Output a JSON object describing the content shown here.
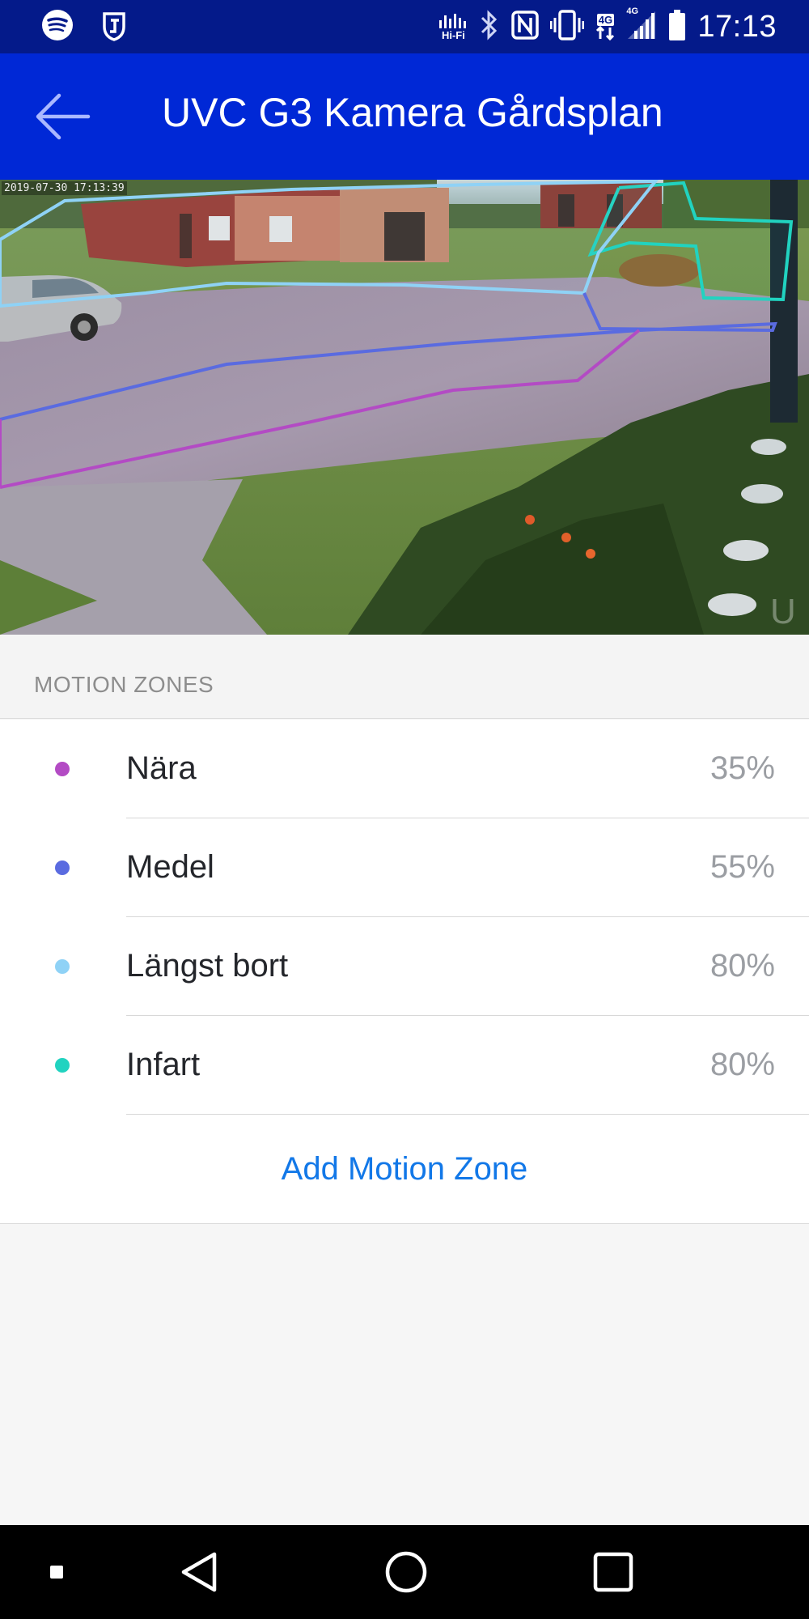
{
  "status_bar": {
    "left_icons": [
      "spotify-icon",
      "app-notification-icon"
    ],
    "hifi_label": "Hi-Fi",
    "network_label": "4G",
    "signal_label": "4G",
    "time": "17:13"
  },
  "app_bar": {
    "title": "UVC G3 Kamera Gårdsplan",
    "back_icon": "back-arrow-icon"
  },
  "camera": {
    "timestamp": "2019-07-30 17:13:39"
  },
  "section": {
    "title": "MOTION ZONES"
  },
  "zones": [
    {
      "name": "Nära",
      "sensitivity": "35%",
      "color": "#b34bc4"
    },
    {
      "name": "Medel",
      "sensitivity": "55%",
      "color": "#5a6be0"
    },
    {
      "name": "Längst bort",
      "sensitivity": "80%",
      "color": "#8fd2f6"
    },
    {
      "name": "Infart",
      "sensitivity": "80%",
      "color": "#21d3c0"
    }
  ],
  "add_zone_label": "Add Motion Zone",
  "colors": {
    "status_bar": "#041a8a",
    "app_bar": "#0028d6",
    "link": "#1278e8"
  },
  "nav_bar": {
    "icons": [
      "recent-apps-icon",
      "back-triangle-icon",
      "home-circle-icon",
      "overview-square-icon"
    ]
  }
}
